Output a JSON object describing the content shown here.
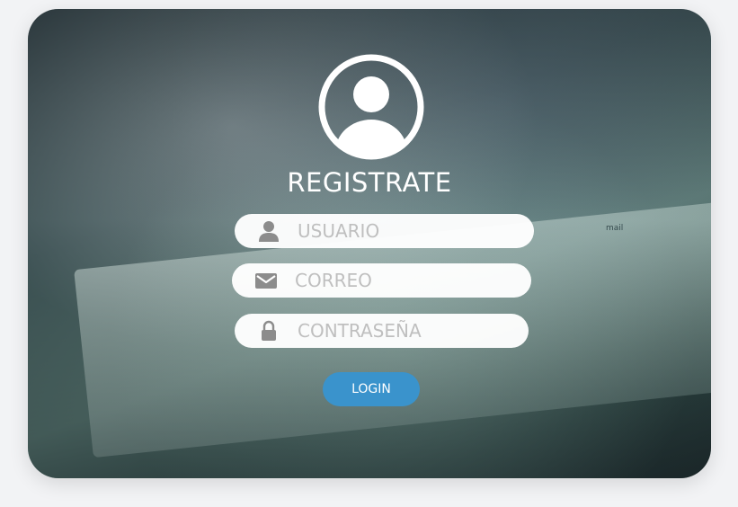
{
  "form": {
    "title": "REGISTRATE",
    "fields": [
      {
        "icon": "user-icon",
        "placeholder": "USUARIO",
        "value": ""
      },
      {
        "icon": "mail-icon",
        "placeholder": "CORREO",
        "value": ""
      },
      {
        "icon": "lock-icon",
        "placeholder": "CONTRASEÑA",
        "value": ""
      }
    ],
    "login_label": "LOGIN"
  },
  "background_text": "mail",
  "colors": {
    "button": "#3a93cc",
    "field_background": "#ffffff",
    "placeholder": "#bfbfbf",
    "icon": "#8c8c8c",
    "title": "#ffffff"
  }
}
